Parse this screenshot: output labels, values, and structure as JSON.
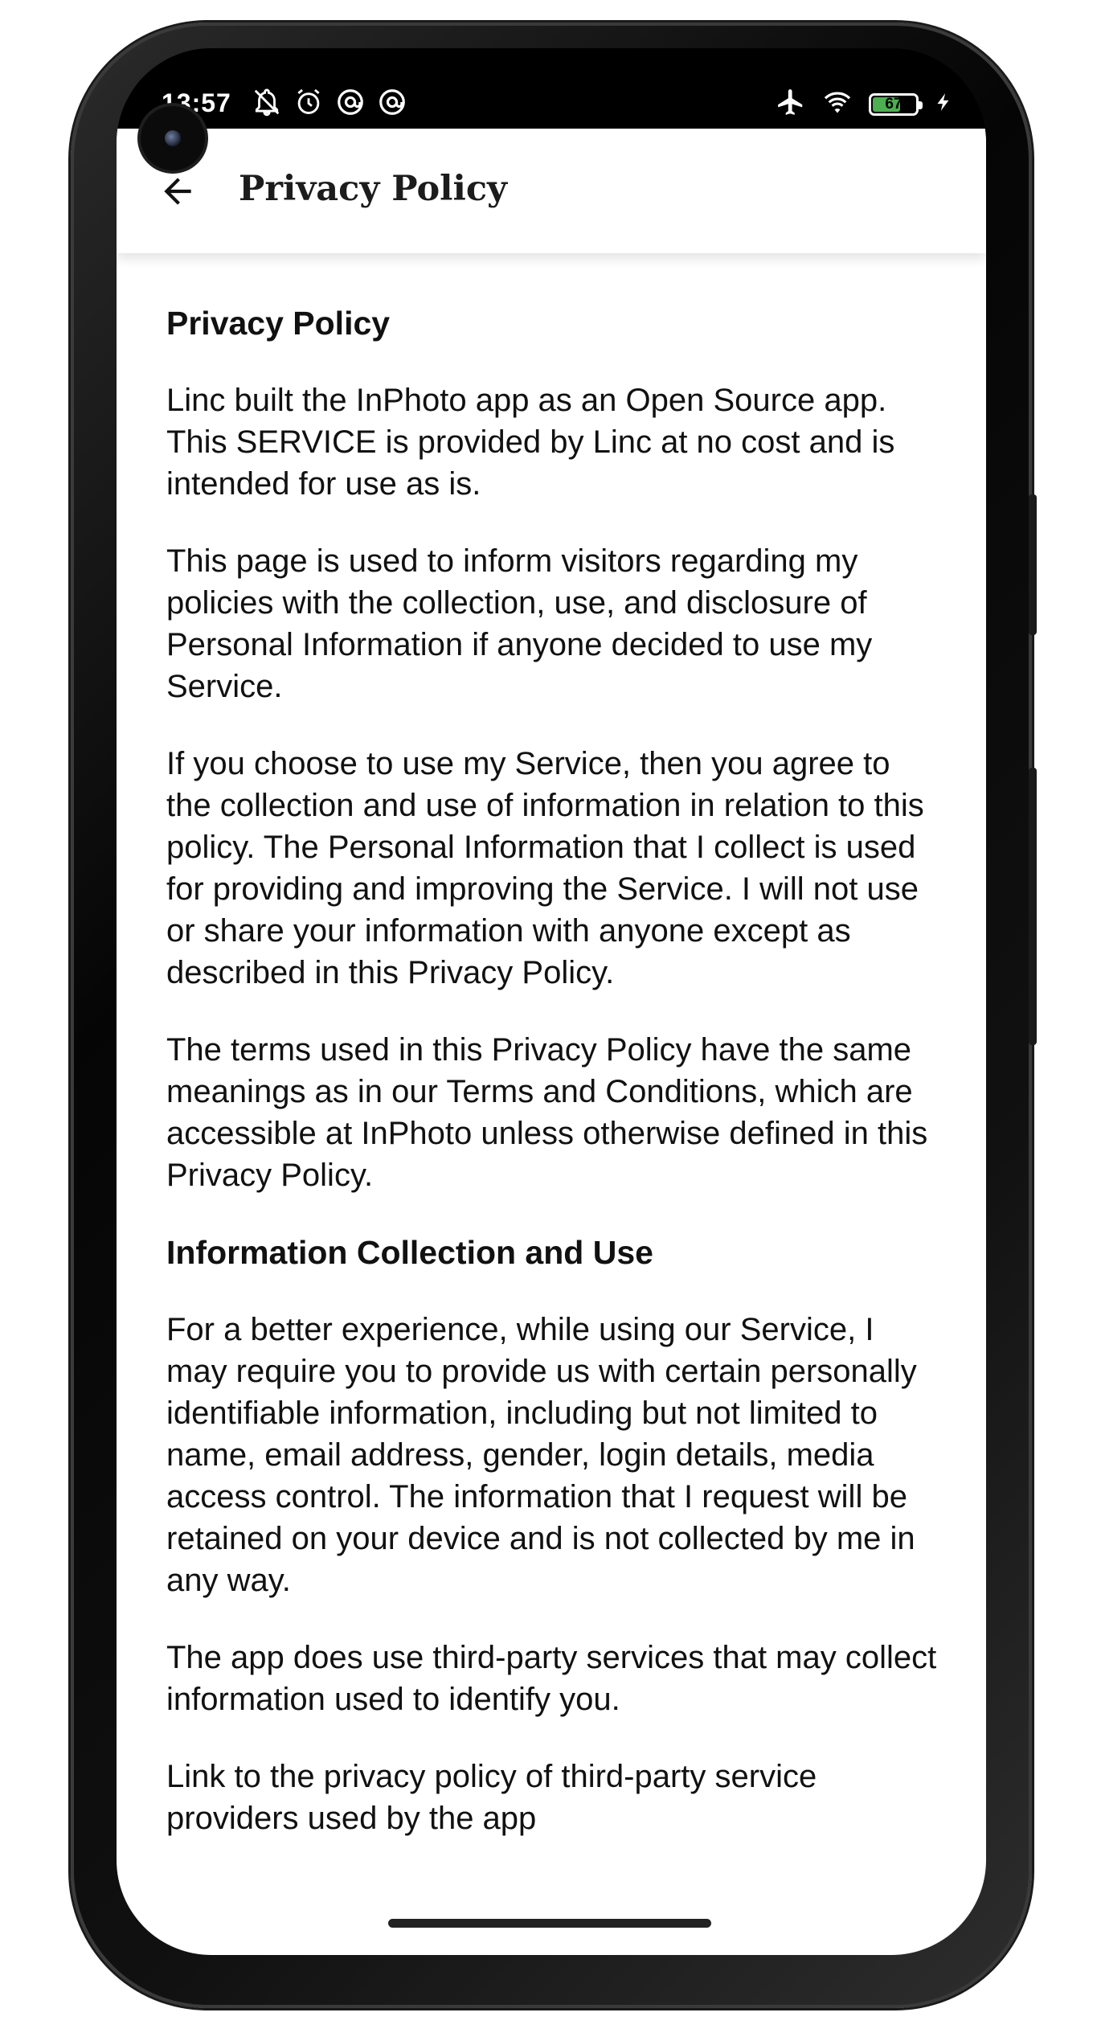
{
  "status_bar": {
    "time": "13:57",
    "battery_level": "67",
    "battery_fraction": 0.67,
    "battery_color": "#4caf50",
    "left_icons": [
      "notifications-off-icon",
      "alarm-icon",
      "at-sign-icon",
      "at-sign-icon"
    ],
    "right_icons": [
      "airplane-mode-icon",
      "wifi-icon",
      "battery-icon",
      "charging-bolt-icon"
    ]
  },
  "app_bar": {
    "back_icon": "arrow-back-icon",
    "title": "Privacy Policy"
  },
  "content": {
    "heading_1": "Privacy Policy",
    "paragraph_1": "Linc built the InPhoto app as an Open Source app. This SERVICE is provided by Linc at no cost and is intended for use as is.",
    "paragraph_2": "This page is used to inform visitors regarding my policies with the collection, use, and disclosure of Personal Information if anyone decided to use my Service.",
    "paragraph_3": "If you choose to use my Service, then you agree to the collection and use of information in relation to this policy. The Personal Information that I collect is used for providing and improving the Service. I will not use or share your information with anyone except as described in this Privacy Policy.",
    "paragraph_4": "The terms used in this Privacy Policy have the same meanings as in our Terms and Conditions, which are accessible at InPhoto unless otherwise defined in this Privacy Policy.",
    "heading_2": "Information Collection and Use",
    "paragraph_5": "For a better experience, while using our Service, I may require you to provide us with certain personally identifiable information, including but not limited to name, email address, gender, login details, media access control. The information that I request will be retained on your device and is not collected by me in any way.",
    "paragraph_6": "The app does use third-party services that may collect information used to identify you.",
    "paragraph_7": "Link to the privacy policy of third-party service providers used by the app"
  }
}
